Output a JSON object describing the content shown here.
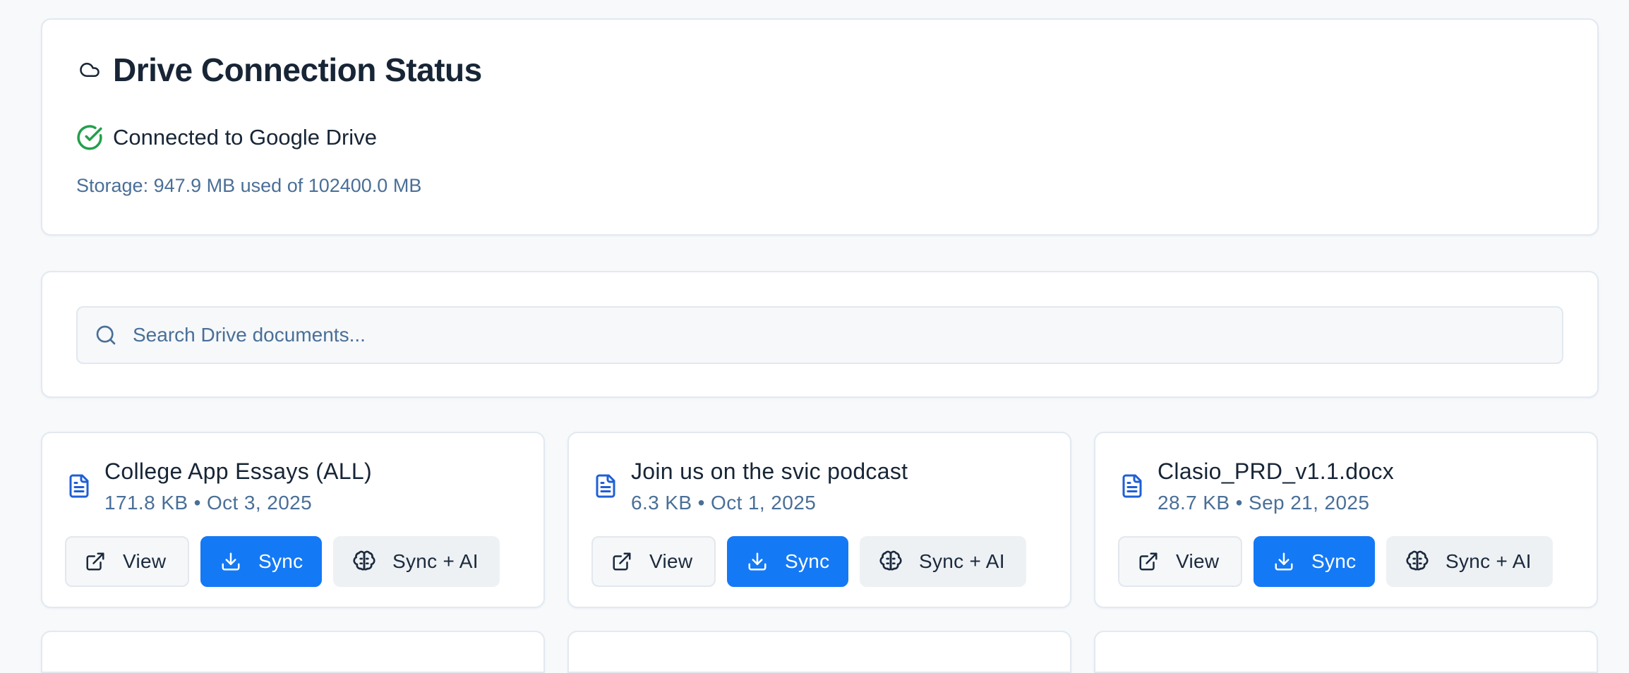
{
  "status": {
    "title": "Drive Connection Status",
    "title_icon": "cloud-icon",
    "connection_text": "Connected to Google Drive",
    "connection_icon": "check-circle-icon",
    "storage_text": "Storage: 947.9 MB used of 102400.0 MB"
  },
  "search": {
    "placeholder": "Search Drive documents...",
    "icon": "search-icon"
  },
  "colors": {
    "accent": "#1479f5",
    "success": "#22a04b",
    "muted_text": "#4a6f97"
  },
  "documents": [
    {
      "name": "College App Essays (ALL)",
      "meta": "171.8 KB • Oct 3, 2025"
    },
    {
      "name": "Join us on the svic podcast",
      "meta": "6.3 KB • Oct 1, 2025"
    },
    {
      "name": "Clasio_PRD_v1.1.docx",
      "meta": "28.7 KB • Sep 21, 2025"
    }
  ],
  "buttons": {
    "view": "View",
    "sync": "Sync",
    "sync_ai": "Sync + AI"
  }
}
